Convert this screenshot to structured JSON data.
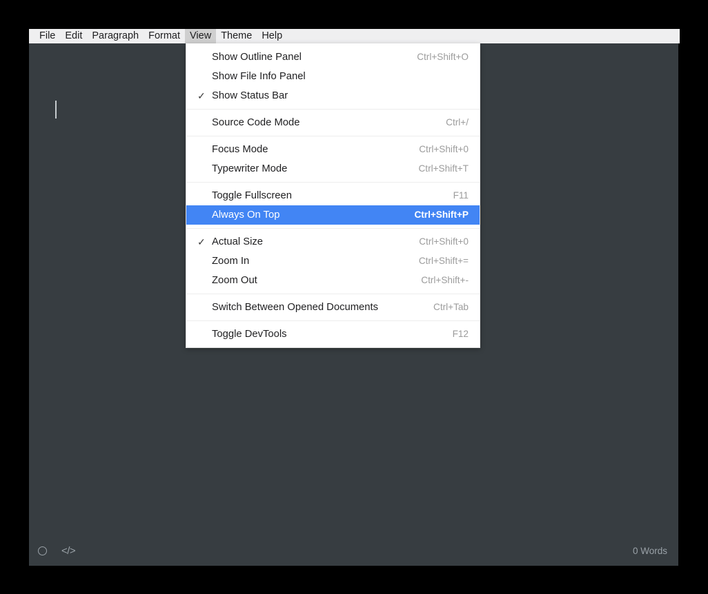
{
  "menubar": {
    "items": [
      {
        "label": "File",
        "active": false
      },
      {
        "label": "Edit",
        "active": false
      },
      {
        "label": "Paragraph",
        "active": false
      },
      {
        "label": "Format",
        "active": false
      },
      {
        "label": "View",
        "active": true
      },
      {
        "label": "Theme",
        "active": false
      },
      {
        "label": "Help",
        "active": false
      }
    ]
  },
  "view_menu": {
    "groups": [
      {
        "items": [
          {
            "label": "Show Outline Panel",
            "shortcut": "Ctrl+Shift+O",
            "checked": false,
            "selected": false
          },
          {
            "label": "Show File Info Panel",
            "shortcut": "",
            "checked": false,
            "selected": false
          },
          {
            "label": "Show Status Bar",
            "shortcut": "",
            "checked": true,
            "selected": false
          }
        ]
      },
      {
        "items": [
          {
            "label": "Source Code Mode",
            "shortcut": "Ctrl+/",
            "checked": false,
            "selected": false
          }
        ]
      },
      {
        "items": [
          {
            "label": "Focus Mode",
            "shortcut": "Ctrl+Shift+0",
            "checked": false,
            "selected": false
          },
          {
            "label": "Typewriter Mode",
            "shortcut": "Ctrl+Shift+T",
            "checked": false,
            "selected": false
          }
        ]
      },
      {
        "items": [
          {
            "label": "Toggle Fullscreen",
            "shortcut": "F11",
            "checked": false,
            "selected": false
          },
          {
            "label": "Always On Top",
            "shortcut": "Ctrl+Shift+P",
            "checked": false,
            "selected": true
          }
        ]
      },
      {
        "items": [
          {
            "label": "Actual Size",
            "shortcut": "Ctrl+Shift+0",
            "checked": true,
            "selected": false
          },
          {
            "label": "Zoom In",
            "shortcut": "Ctrl+Shift+=",
            "checked": false,
            "selected": false
          },
          {
            "label": "Zoom Out",
            "shortcut": "Ctrl+Shift+-",
            "checked": false,
            "selected": false
          }
        ]
      },
      {
        "items": [
          {
            "label": "Switch Between Opened Documents",
            "shortcut": "Ctrl+Tab",
            "checked": false,
            "selected": false
          }
        ]
      },
      {
        "items": [
          {
            "label": "Toggle DevTools",
            "shortcut": "F12",
            "checked": false,
            "selected": false
          }
        ]
      }
    ],
    "check_glyph": "✓"
  },
  "editor": {
    "content": ""
  },
  "statusbar": {
    "outline_icon": "circle-icon",
    "source_code_icon": "</>",
    "word_count": "0 Words"
  },
  "colors": {
    "menu_highlight": "#4285f4",
    "editor_background": "#373d41",
    "menubar_background": "#efeff0",
    "menu_active_background": "#cfcfcf",
    "status_text": "#9aa2a8"
  }
}
